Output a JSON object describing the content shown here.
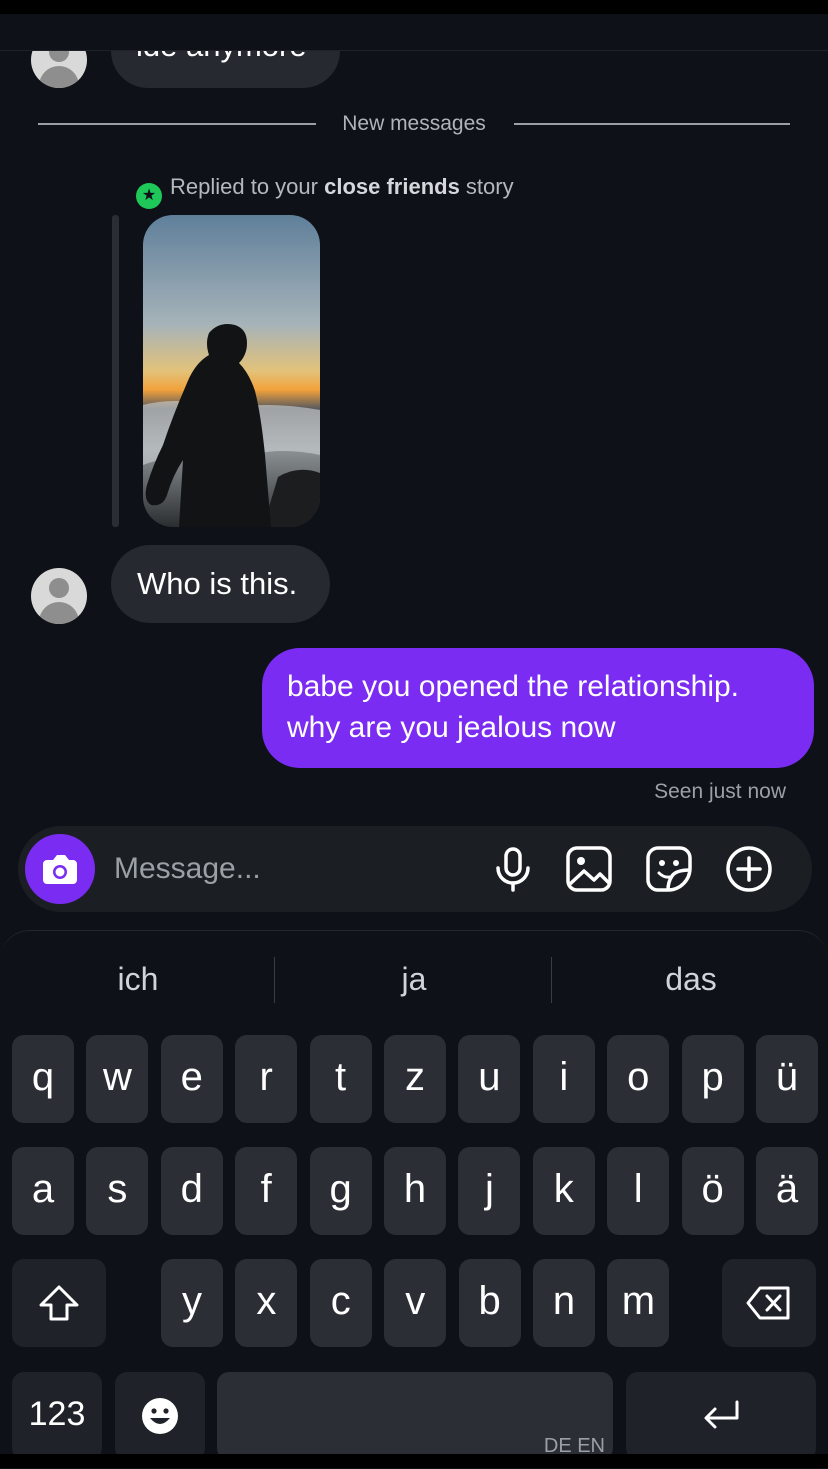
{
  "colors": {
    "background": "#0e1117",
    "outgoing_bubble": "#7a2cf2",
    "incoming_bubble": "#262a30",
    "close_friends_green": "#1ec95a"
  },
  "messages": {
    "partial_top_text": "ide anymore",
    "new_messages_label": "New messages",
    "reply_prefix": "Replied to your ",
    "reply_emphasis": "close friends",
    "reply_suffix": " story",
    "incoming_text": "Who is this.",
    "outgoing_line1": "babe you opened the relationship.",
    "outgoing_line2": "why are you jealous now",
    "seen_status": "Seen just now"
  },
  "composer": {
    "placeholder": "Message...",
    "icons": [
      "camera-icon",
      "microphone-icon",
      "gallery-icon",
      "sticker-icon",
      "plus-icon"
    ]
  },
  "keyboard": {
    "suggestions": [
      "ich",
      "ja",
      "das"
    ],
    "row1": [
      "q",
      "w",
      "e",
      "r",
      "t",
      "z",
      "u",
      "i",
      "o",
      "p",
      "ü"
    ],
    "row2": [
      "a",
      "s",
      "d",
      "f",
      "g",
      "h",
      "j",
      "k",
      "l",
      "ö",
      "ä"
    ],
    "row3": [
      "y",
      "x",
      "c",
      "v",
      "b",
      "n",
      "m"
    ],
    "numbers_label": "123",
    "language_label": "DE EN"
  }
}
